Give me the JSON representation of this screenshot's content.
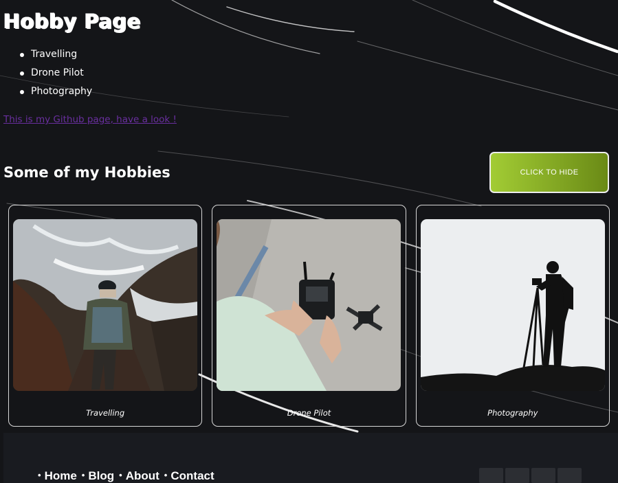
{
  "page": {
    "title": "Hobby Page"
  },
  "hobby_list": [
    "Travelling",
    "Drone Pilot",
    "Photography"
  ],
  "github_link": "This is my Github page, have a look !",
  "section": {
    "heading": "Some of my Hobbies",
    "button_label": "CLICK TO HIDE"
  },
  "cards": [
    {
      "caption": "Travelling",
      "photo": "hiker-on-coastal-steps"
    },
    {
      "caption": "Drone Pilot",
      "photo": "hands-holding-drone-controller"
    },
    {
      "caption": "Photography",
      "photo": "photographer-silhouette-tripod"
    }
  ],
  "footer": {
    "nav": [
      "Home",
      "Blog",
      "About",
      "Contact"
    ],
    "social_icon_count": 4
  },
  "colors": {
    "background": "#141518",
    "button_start": "#a2cc34",
    "button_end": "#6a8a16",
    "link": "#6a2fa0"
  }
}
